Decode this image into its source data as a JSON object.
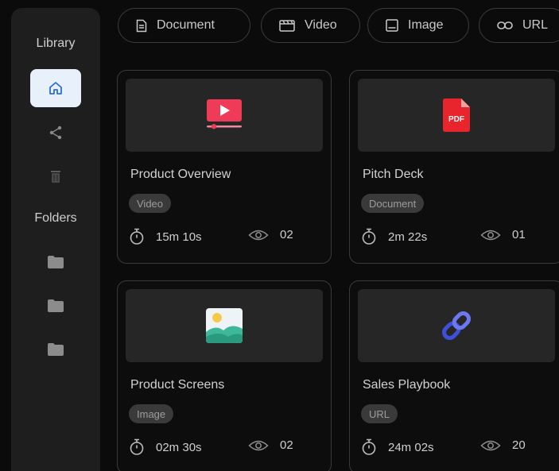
{
  "sidebar": {
    "library_label": "Library",
    "folders_label": "Folders",
    "nav": [
      {
        "icon": "home-icon",
        "active": true
      },
      {
        "icon": "share-icon"
      },
      {
        "icon": "trash-icon"
      }
    ],
    "folders": [
      {
        "icon": "folder-icon"
      },
      {
        "icon": "folder-icon"
      },
      {
        "icon": "folder-icon"
      }
    ]
  },
  "filters": [
    {
      "label": "Document",
      "icon": "document-icon"
    },
    {
      "label": "Video",
      "icon": "video-icon"
    },
    {
      "label": "Image",
      "icon": "image-icon"
    },
    {
      "label": "URL",
      "icon": "link-icon"
    }
  ],
  "cards": [
    {
      "title": "Product Overview",
      "type": "Video",
      "duration": "15m 10s",
      "views": "02",
      "thumb_icon": "video-player-icon"
    },
    {
      "title": "Pitch Deck",
      "type": "Document",
      "duration": "2m 22s",
      "views": "01",
      "thumb_icon": "pdf-icon"
    },
    {
      "title": "Product Screens",
      "type": "Image",
      "duration": "02m 30s",
      "views": "02",
      "thumb_icon": "picture-icon"
    },
    {
      "title": "Sales Playbook",
      "type": "URL",
      "duration": "24m 02s",
      "views": "20",
      "thumb_icon": "chain-link-icon"
    }
  ],
  "colors": {
    "background": "#0b0b0b",
    "sidebar": "#1e1e1e",
    "active_nav": "#e8f1fb",
    "accent_blue": "#2f6fd6",
    "video_red": "#ef3b58",
    "pdf_red": "#e8242c",
    "link_blue": "#3f4fd8"
  }
}
